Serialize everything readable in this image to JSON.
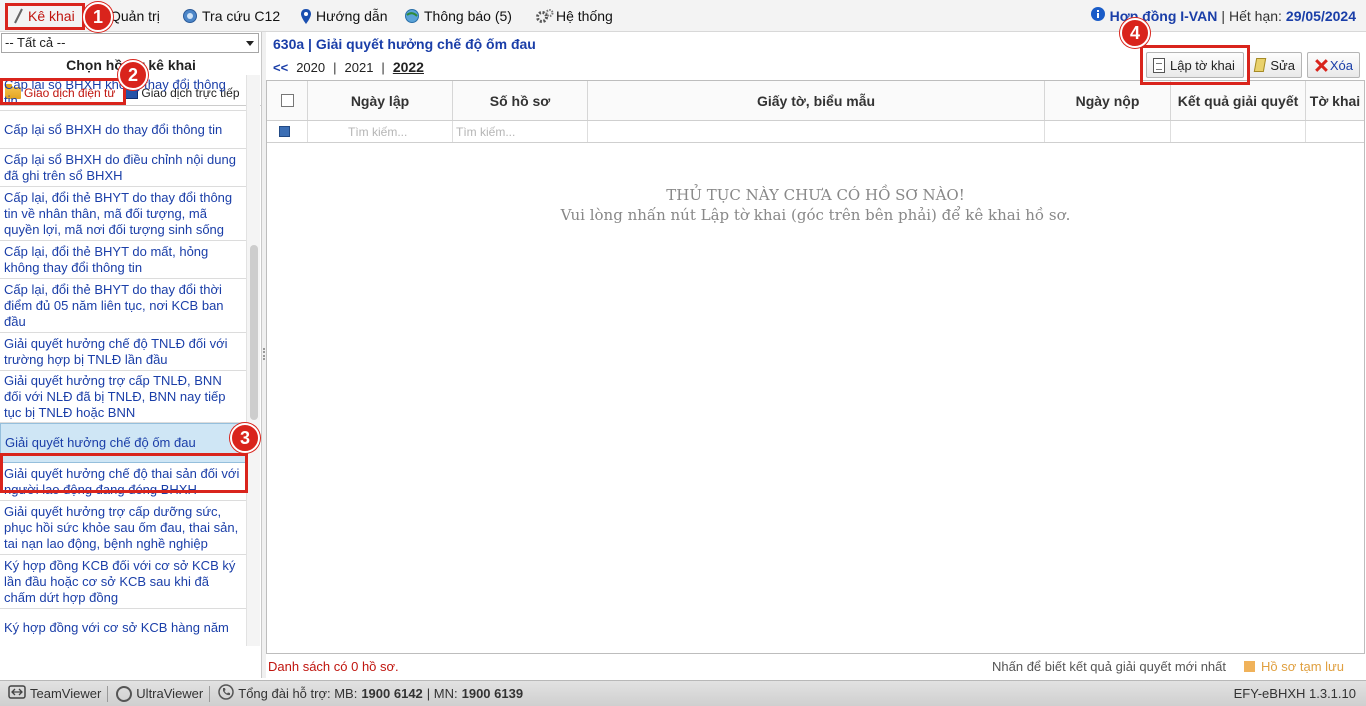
{
  "menu": {
    "items": [
      {
        "label": "Kê khai",
        "icon": "pen-icon"
      },
      {
        "label": "Quản trị",
        "icon": "admin-icon"
      },
      {
        "label": "Tra cứu C12",
        "icon": "search-globe-icon"
      },
      {
        "label": "Hướng dẫn",
        "icon": "location-pin-icon"
      },
      {
        "label": "Thông báo (5)",
        "icon": "globe-icon"
      },
      {
        "label": "Hệ thống",
        "icon": "gears-icon"
      }
    ]
  },
  "contract": {
    "label": "Hợp đồng I-VAN",
    "expiry_label": "Hết hạn:",
    "expiry_date": "29/05/2024"
  },
  "left": {
    "select_value": "-- Tất cả --",
    "title": "Chọn hồ sơ kê khai",
    "modes": [
      "Giao dịch điện tử",
      "Giao dịch trực tiếp"
    ],
    "procedures": [
      "Cấp lại sổ BHXH không thay đổi thông tin",
      "Cấp lại sổ BHXH do thay đổi thông tin",
      "Cấp lại sổ BHXH do điều chỉnh nội dung đã ghi trên sổ BHXH",
      "Cấp lại, đổi thẻ BHYT do thay đổi thông tin về nhân thân, mã đối tượng, mã quyền lợi, mã nơi đối tượng sinh sống",
      "Cấp lại, đổi thẻ BHYT do mất, hỏng không thay đổi thông tin",
      "Cấp lại, đổi thẻ BHYT do thay đổi thời điểm đủ 05 năm liên tục, nơi KCB ban đầu",
      "Giải quyết hưởng chế độ TNLĐ đối với trường hợp bị TNLĐ lần đầu",
      "Giải quyết hưởng trợ cấp TNLĐ, BNN đối với NLĐ đã bị TNLĐ, BNN nay tiếp tục bị TNLĐ hoặc BNN",
      "Giải quyết hưởng chế độ ốm đau",
      "Giải quyết hưởng chế độ thai sản đối với người  lao động đang đóng BHXH",
      "Giải quyết hưởng trợ cấp dưỡng sức, phục hồi sức khỏe sau ốm đau, thai sản, tai nạn lao động, bệnh nghề nghiệp",
      "Ký hợp đồng KCB đối với cơ sở KCB ký lần đầu hoặc cơ sở KCB sau khi đã chấm dứt hợp đồng",
      "Ký hợp đồng với cơ sở KCB hàng năm"
    ]
  },
  "main": {
    "title": "630a | Giải quyết hưởng chế độ ốm đau",
    "years": {
      "prev": "<<",
      "list": [
        "2020",
        "2021"
      ],
      "current": "2022"
    },
    "toolbar": {
      "create": "Lập tờ khai",
      "edit": "Sửa",
      "delete": "Xóa"
    },
    "columns": [
      "Ngày lập",
      "Số hồ sơ",
      "Giấy tờ, biểu mẫu",
      "Ngày nộp",
      "Kết quả giải quyết",
      "Tờ khai"
    ],
    "search_placeholder": "Tìm kiếm...",
    "empty_line1": "THỦ TỤC NÀY CHƯA CÓ HỒ SƠ NÀO!",
    "empty_line2": "Vui lòng nhấn nút Lập tờ khai (góc trên bên phải) để kê khai hồ sơ.",
    "status_count": "Danh sách có 0 hồ sơ.",
    "status_hint": "Nhấn để biết kết quả giải quyết mới nhất",
    "status_saved": "Hồ sơ tạm lưu"
  },
  "footer": {
    "teamviewer": "TeamViewer",
    "ultraviewer": "UltraViewer",
    "hotline_label": "Tổng đài hỗ trợ: MB:",
    "hotline_mb": "1900 6142",
    "hotline_mn_label": "| MN:",
    "hotline_mn": "1900 6139",
    "version": "EFY-eBHXH 1.3.1.10"
  },
  "callouts": [
    "1",
    "2",
    "3",
    "4"
  ],
  "colors": {
    "accent_red": "#d9241c",
    "link_blue": "#1a3ea8",
    "selected_bg": "#cfe6f5"
  }
}
